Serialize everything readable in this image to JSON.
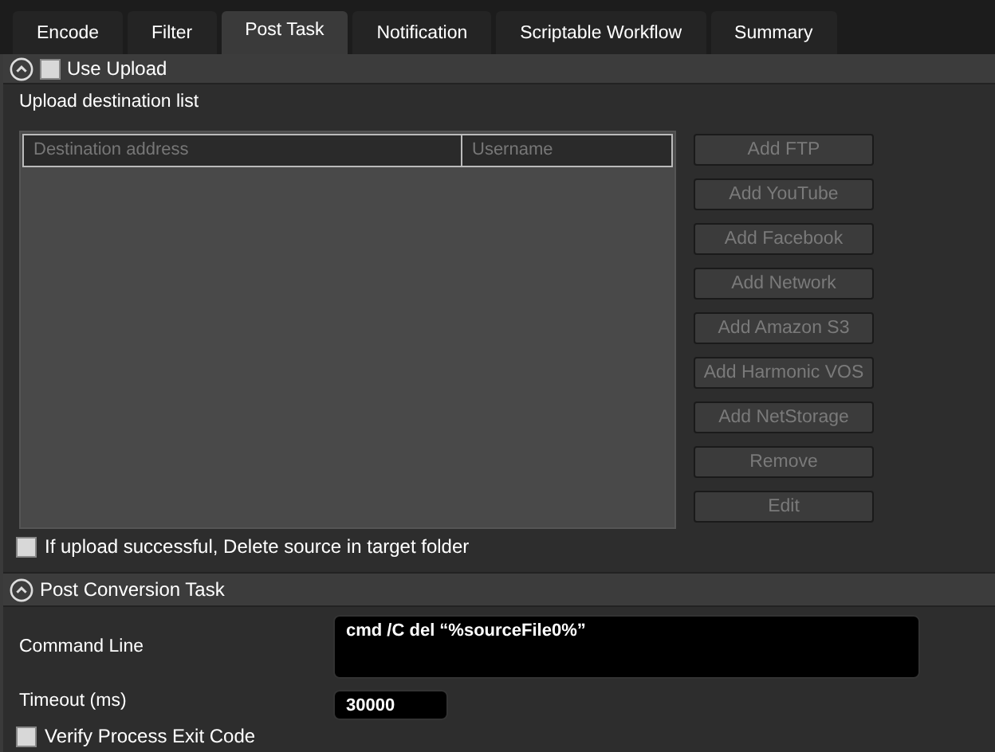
{
  "tabs": [
    {
      "label": "Encode",
      "selected": false
    },
    {
      "label": "Filter",
      "selected": false
    },
    {
      "label": "Post Task",
      "selected": true
    },
    {
      "label": "Notification",
      "selected": false
    },
    {
      "label": "Scriptable Workflow",
      "selected": false
    },
    {
      "label": "Summary",
      "selected": false
    }
  ],
  "upload_section": {
    "title": "Use Upload",
    "expanded": true,
    "checked": false,
    "list_label": "Upload destination list",
    "table": {
      "columns": [
        "Destination address",
        "Username"
      ]
    },
    "buttons": [
      {
        "label": "Add FTP",
        "disabled": true
      },
      {
        "label": "Add YouTube",
        "disabled": true
      },
      {
        "label": "Add Facebook",
        "disabled": true
      },
      {
        "label": "Add Network",
        "disabled": true
      },
      {
        "label": "Add Amazon S3",
        "disabled": true
      },
      {
        "label": "Add Harmonic VOS",
        "disabled": true
      },
      {
        "label": "Add NetStorage",
        "disabled": true
      },
      {
        "label": "Remove",
        "disabled": true
      },
      {
        "label": "Edit",
        "disabled": true
      }
    ],
    "delete_option": {
      "label": "If upload successful, Delete source in target folder",
      "checked": false
    }
  },
  "post_section": {
    "title": "Post Conversion Task",
    "expanded": true,
    "command_line": {
      "label": "Command Line",
      "value": "cmd /C del “%sourceFile0%”"
    },
    "timeout": {
      "label": "Timeout (ms)",
      "value": "30000"
    },
    "verify_option": {
      "label": "Verify Process Exit Code",
      "checked": false
    }
  }
}
